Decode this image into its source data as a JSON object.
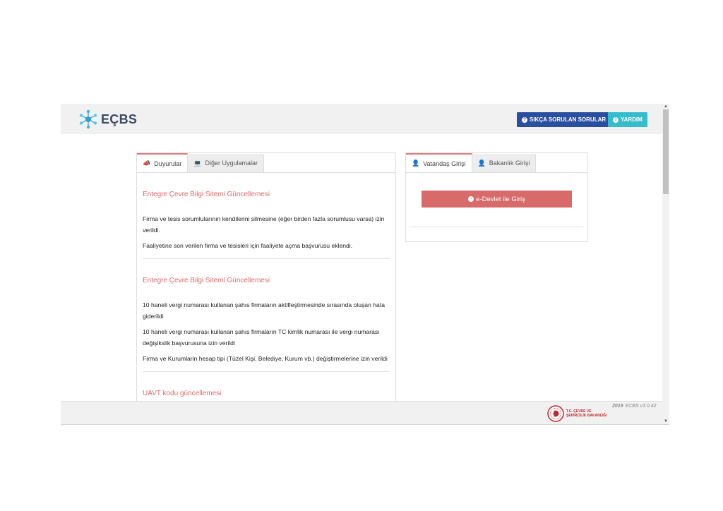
{
  "header": {
    "logo_text": "EÇBS",
    "faq_button": "SIKÇA SORULAN SORULAR",
    "help_button": "YARDIM"
  },
  "left_panel": {
    "tabs": [
      {
        "label": "Duyurular",
        "icon": "megaphone-icon",
        "active": true
      },
      {
        "label": "Diğer Uygulamalar",
        "icon": "laptop-icon",
        "active": false
      }
    ],
    "news": [
      {
        "title": "Entegre Çevre Bilgi Sitemi Güncellemesi",
        "items": [
          "Firma ve tesis sorumlularının kendilerini silmesine (eğer birden fazla sorumlusu varsa) izin verildi.",
          "Faaliyetine son verilen firma ve tesisleri için faaliyete açma başvurusu eklendi."
        ]
      },
      {
        "title": "Entegre Çevre Bilgi Sitemi Güncellemesi",
        "items": [
          "10 haneli vergi numarası kullanan şahıs firmaların aktifleştirmesinde sırasında oluşan hata giderildi",
          "10 haneli vergi numarası kullanan şahıs firmaların TC kimlik numarası ile vergi numarası değişikslik başvurusuna izin verildi",
          "Firma ve Kurumlarin hesap tipi (Tüzel Kişi, Belediye, Kurum vb.) değiştirmelerine izin verildi"
        ]
      },
      {
        "title": "UAVT kodu güncellemesi",
        "items": []
      }
    ]
  },
  "right_panel": {
    "tabs": [
      {
        "label": "Vatandaş Girişi",
        "icon": "user-icon",
        "active": true
      },
      {
        "label": "Bakanlık Girişi",
        "icon": "user-icon",
        "active": false
      }
    ],
    "login_button": "e-Devlet ile Giriş"
  },
  "footer": {
    "ministry_line1": "T.C. ÇEVRE VE",
    "ministry_line2": "ŞEHİRCİLİK BAKANLIĞI",
    "year": "2019",
    "version": "ECBS v3.0.42"
  },
  "colors": {
    "accent_red": "#d96a6a",
    "faq_blue": "#2a4ea0",
    "help_cyan": "#35bccd",
    "logo_teal": "#2e9fd8"
  }
}
